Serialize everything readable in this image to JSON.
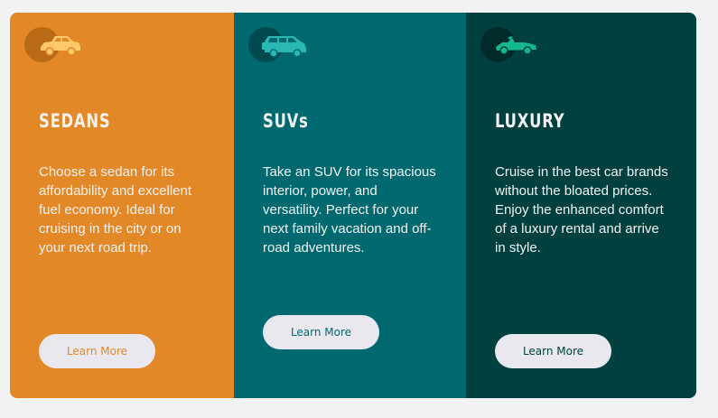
{
  "cards": [
    {
      "key": "sedans",
      "icon": "sedan-car-icon",
      "title": "SEDANS",
      "description": "Choose a sedan for its affordability and excellent fuel economy. Ideal for cruising in the city or on your next road trip.",
      "button_label": "Learn More",
      "background": "#e38826"
    },
    {
      "key": "suvs",
      "icon": "suv-car-icon",
      "title": "SUVs",
      "description": "Take an SUV for its spacious interior, power, and versatility. Perfect for your next family vacation and off-road adventures.",
      "button_label": "Learn More",
      "background": "#006970"
    },
    {
      "key": "luxury",
      "icon": "luxury-car-icon",
      "title": "LUXURY",
      "description": "Cruise in the best car brands without the bloated prices. Enjoy the enhanced comfort of a luxury rental and arrive in style.",
      "button_label": "Learn More",
      "background": "#00403f"
    }
  ],
  "colors": {
    "page_background": "#f2f2f2",
    "text_light": "#f2f2f2",
    "button_background": "#e9e8ef"
  }
}
